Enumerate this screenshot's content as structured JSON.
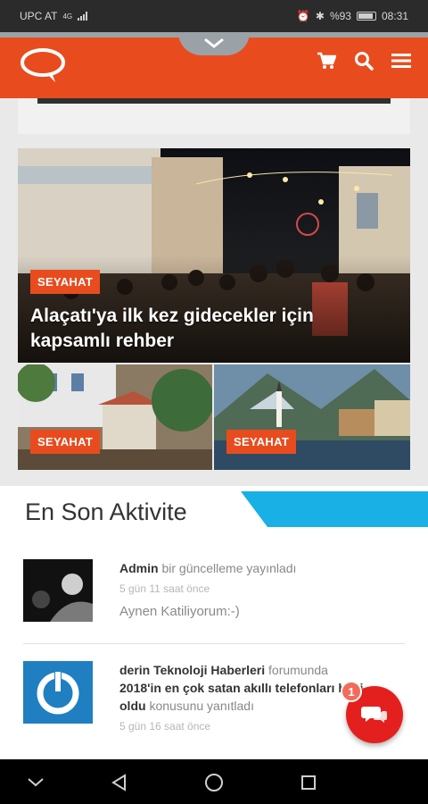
{
  "status_bar": {
    "carrier": "UPC AT",
    "signal_label": "4G",
    "battery": "%93",
    "time": "08:31"
  },
  "header": {
    "logo": "chat-bubble-logo",
    "icons": [
      "cart-icon",
      "search-icon",
      "menu-icon"
    ]
  },
  "featured": {
    "tag": "SEYAHAT",
    "title": "Alaçatı'ya ilk kez gidecekler için kapsamlı rehber",
    "sub_left_tag": "SEYAHAT",
    "sub_right_tag": "SEYAHAT"
  },
  "activity": {
    "title": "En Son Aktivite",
    "items": [
      {
        "user": "Admin",
        "action": "bir güncelleme yayınladı",
        "time": "5 gün 11 saat önce",
        "text": "Aynen Katiliyorum:-)"
      },
      {
        "user": "derin Teknoloji Haberleri",
        "action_prefix": "forumunda",
        "topic": "2018'in en çok satan akıllı telefonları belli oldu",
        "action_suffix": "konusunu yanıtladı",
        "time": "5 gün 16 saat önce"
      }
    ]
  },
  "chat_fab": {
    "badge": "1"
  },
  "nav": {
    "icons": [
      "chevron-down-icon",
      "back-icon",
      "home-icon",
      "recents-icon"
    ]
  },
  "colors": {
    "brand": "#e84c1e",
    "accent_blue": "#19b0e6",
    "fab": "#e4201e"
  }
}
